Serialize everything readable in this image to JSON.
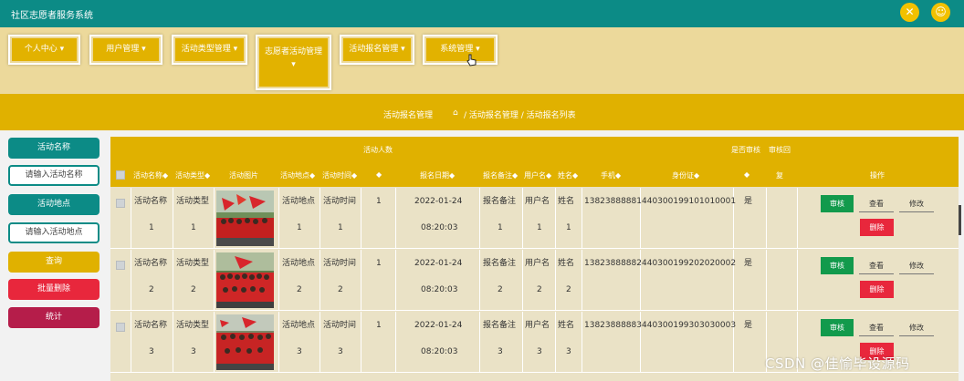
{
  "app": {
    "title": "社区志愿者服务系统"
  },
  "header_icons": {
    "tools": "tools-icon",
    "user": "user-icon"
  },
  "nav": [
    {
      "label": "个人中心"
    },
    {
      "label": "用户管理"
    },
    {
      "label": "活动类型管理"
    },
    {
      "label": "志愿者活动管理"
    },
    {
      "label": "活动报名管理"
    },
    {
      "label": "系统管理"
    }
  ],
  "breadcrumb": {
    "title": "活动报名管理",
    "path": "/ 活动报名管理 / 活动报名列表"
  },
  "sidebar": {
    "activity_name_label": "活动名称",
    "activity_name_placeholder": "请输入活动名称",
    "activity_place_label": "活动地点",
    "activity_place_placeholder": "请输入活动地点",
    "search": "查询",
    "batch_delete": "批量删除",
    "stats": "统计"
  },
  "table": {
    "top_headers": {
      "people": "活动人数",
      "approved": "是否审核",
      "reply": "审核回",
      "reply_cont": "复"
    },
    "columns": {
      "name": "活动名称◆",
      "type": "活动类型◆",
      "image": "活动图片",
      "place": "活动地点◆",
      "time": "活动时间◆",
      "count": "◆",
      "date": "报名日期◆",
      "note": "报名备注◆",
      "user": "用户名◆",
      "realname": "姓名◆",
      "phone": "手机◆",
      "idcard": "身份证◆",
      "approved": "◆",
      "actions": "操作"
    },
    "rows": [
      {
        "name": "活动名称",
        "name2": "1",
        "type": "活动类型",
        "type2": "1",
        "place": "活动地点",
        "place2": "1",
        "time": "活动时间",
        "time2": "1",
        "count": "1",
        "date": "2022-01-24",
        "clock": "08:20:03",
        "note": "报名备注",
        "note2": "1",
        "user": "用户名",
        "user2": "1",
        "realname": "姓名",
        "realname2": "1",
        "phone": "13823888881",
        "idcard": "440300199101010001",
        "approved": "是"
      },
      {
        "name": "活动名称",
        "name2": "2",
        "type": "活动类型",
        "type2": "2",
        "place": "活动地点",
        "place2": "2",
        "time": "活动时间",
        "time2": "2",
        "count": "1",
        "date": "2022-01-24",
        "clock": "08:20:03",
        "note": "报名备注",
        "note2": "2",
        "user": "用户名",
        "user2": "2",
        "realname": "姓名",
        "realname2": "2",
        "phone": "13823888882",
        "idcard": "440300199202020002",
        "approved": "是"
      },
      {
        "name": "活动名称",
        "name2": "3",
        "type": "活动类型",
        "type2": "3",
        "place": "活动地点",
        "place2": "3",
        "time": "活动时间",
        "time2": "3",
        "count": "1",
        "date": "2022-01-24",
        "clock": "08:20:03",
        "note": "报名备注",
        "note2": "3",
        "user": "用户名",
        "user2": "3",
        "realname": "姓名",
        "realname2": "3",
        "phone": "13823888883",
        "idcard": "440300199303030003",
        "approved": "是"
      }
    ],
    "actions": {
      "audit": "审核",
      "view": "查看",
      "edit": "修改",
      "delete": "删除"
    }
  },
  "watermark": "CSDN @佳愉毕设源码",
  "colors": {
    "teal": "#0c8b86",
    "gold": "#e0b100",
    "green": "#129a4c",
    "red": "#e8273c",
    "crimson": "#b51d4a"
  }
}
